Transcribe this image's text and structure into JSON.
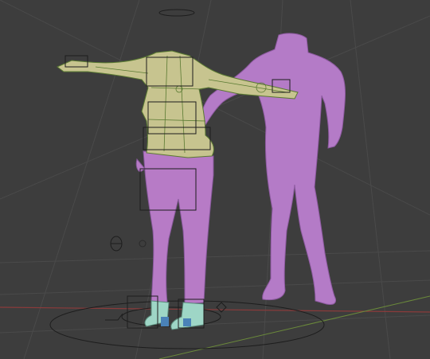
{
  "viewport": {
    "background": "#3d3d3d",
    "grid_color": "#4a4a4a",
    "x_axis_color": "#8a3b3b",
    "y_axis_color": "#6b8a3b"
  },
  "objects": {
    "jacket": {
      "icon": "jacket-mesh",
      "color": "#c7c48f",
      "wire_color": "#5a7a32"
    },
    "pants": {
      "icon": "pants-mesh",
      "color": "#b77bc6"
    },
    "body_figure": {
      "icon": "body-mesh",
      "color": "#b47bc7"
    },
    "shoes": {
      "icon": "shoe-mesh",
      "color": "#9ed6c6"
    },
    "armature": {
      "icon": "armature-bones",
      "color": "#1d1d1d"
    }
  }
}
